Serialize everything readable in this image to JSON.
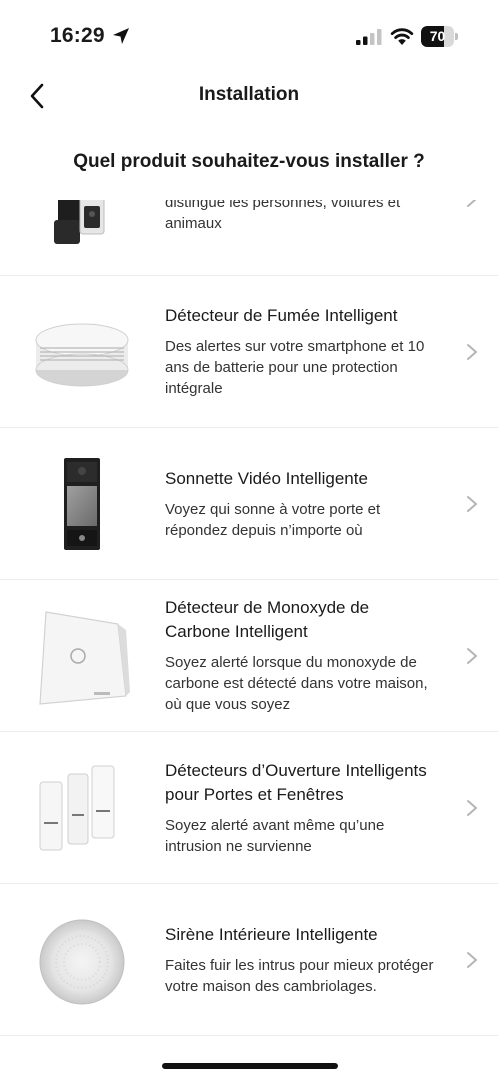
{
  "status_bar": {
    "time": "16:29",
    "battery_level": "70",
    "battery_fraction": 0.7
  },
  "nav": {
    "title": "Installation",
    "back_icon": "chevron-left-icon"
  },
  "heading": "Quel produit souhaitez-vous installer ?",
  "products": [
    {
      "title": "",
      "description": "La caméra extérieure de sécurité qui distingue les personnes, voitures et animaux",
      "icon": "outdoor-camera-icon"
    },
    {
      "title": "Détecteur de Fumée Intelligent",
      "description": "Des alertes sur votre smartphone et 10 ans de batterie pour une protection intégrale",
      "icon": "smoke-detector-icon"
    },
    {
      "title": "Sonnette Vidéo Intelligente",
      "description": "Voyez qui sonne à votre porte et répondez depuis n’importe où",
      "icon": "video-doorbell-icon"
    },
    {
      "title": "Détecteur de Monoxyde de Carbone Intelligent",
      "description": "Soyez alerté lorsque du monoxyde de carbone est détecté dans votre maison, où que vous soyez",
      "icon": "co-detector-icon"
    },
    {
      "title": "Détecteurs d’Ouverture Intelligents pour Portes et Fenêtres",
      "description": "Soyez alerté avant même qu’une intrusion ne survienne",
      "icon": "door-window-sensor-icon"
    },
    {
      "title": "Sirène Intérieure Intelligente",
      "description": "Faites fuir les intrus pour mieux protéger votre maison des cambriolages.",
      "icon": "indoor-siren-icon"
    }
  ],
  "colors": {
    "text": "#1a1a1a",
    "divider": "#ececec",
    "chevron": "#b5b5b5"
  }
}
